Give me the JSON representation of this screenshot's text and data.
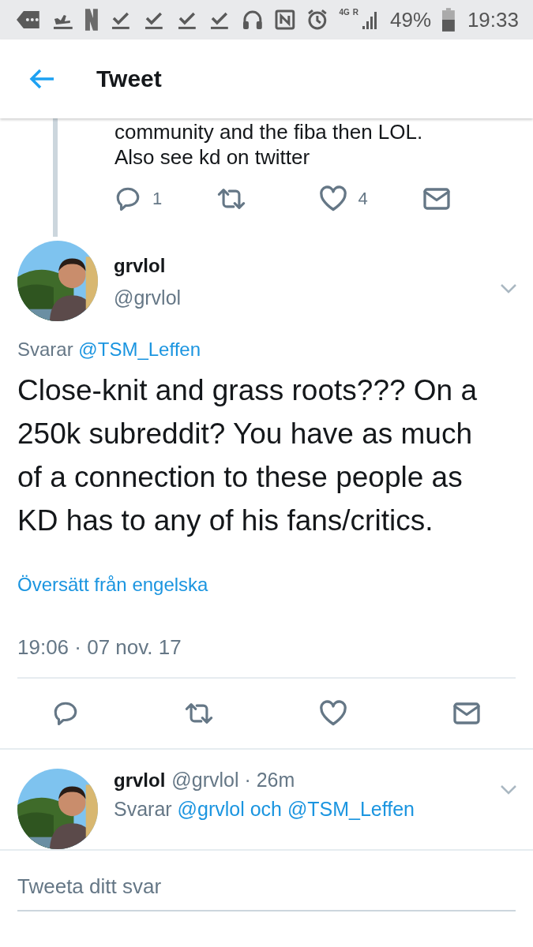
{
  "status_bar": {
    "network": "4G",
    "roaming": "R",
    "battery": "49%",
    "time": "19:33"
  },
  "header": {
    "title": "Tweet"
  },
  "previous_tweet": {
    "text_cut": "community and the fiba then LOL.",
    "text": "Also see kd on twitter",
    "actions": [
      {
        "kind": "reply",
        "count": "1"
      },
      {
        "kind": "retweet"
      },
      {
        "kind": "like",
        "count": "4"
      },
      {
        "kind": "message"
      }
    ]
  },
  "tweet": {
    "name": "grvlol",
    "handle": "@grvlol",
    "reply_prefix": "Svarar",
    "reply_to": "@TSM_Leffen",
    "text": "Close-knit and grass roots??? On a 250k subreddit? You have as much of a connection to these people as KD has to any of his fans/critics.",
    "translate": "Översätt från engelska",
    "timestamp": "19:06 · 07 nov. 17",
    "actions": [
      {
        "kind": "reply"
      },
      {
        "kind": "retweet"
      },
      {
        "kind": "like"
      },
      {
        "kind": "message"
      }
    ]
  },
  "reply": {
    "name": "grvlol",
    "handle": "@grvlol · 26m",
    "reply_prefix": "Svarar",
    "reply_to": "@grvlol och @TSM_Leffen"
  },
  "composer": {
    "placeholder": "Tweeta ditt svar"
  }
}
